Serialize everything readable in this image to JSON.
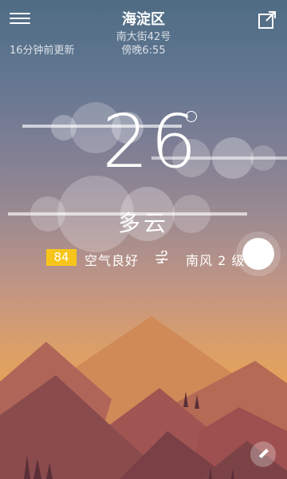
{
  "header": {
    "location": "海淀区",
    "street": "南大街42号",
    "period": "傍晚6:55",
    "updated": "16分钟前更新"
  },
  "weather": {
    "temperature": "26",
    "condition": "多云",
    "aqi_value": "84",
    "aqi_label": "空气良好",
    "wind": "南风  2 级"
  },
  "icons": {
    "menu": "hamburger-menu-icon",
    "share": "share-icon",
    "wind": "wind-icon",
    "edit": "pencil-icon"
  },
  "colors": {
    "aqi_badge": "#f7c51a",
    "sky_top": "#4f6c84",
    "sky_bottom": "#e8a64a"
  }
}
